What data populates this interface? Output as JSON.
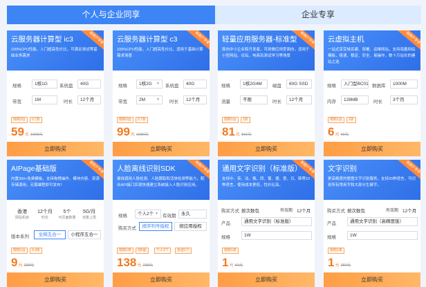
{
  "tabs": [
    "个人与企业同享",
    "企业专享"
  ],
  "products": [
    {
      "title": "云服务器计算型 ic3",
      "desc": "100%CPU性能，入门超高性价比，可满足测试等基础业务需求",
      "ribbon": "新用户专享",
      "specs": {
        "spec_label": "规格",
        "spec_value": "1核1G",
        "disk_label": "系统盘",
        "disk_value": "40G",
        "bw_label": "带宽",
        "bw_value": "1M",
        "dur_label": "时长",
        "dur_value": "12个月"
      },
      "badges": [
        "限购2台",
        "0.7折"
      ],
      "price": "59",
      "unit": "元",
      "old_price": "1008元",
      "buy": "立即购买"
    },
    {
      "title": "云服务器计算型 c3",
      "desc": "100%CPU性能，入门超高性价比，适用于基础计算需求场景",
      "ribbon": "新用户专享",
      "specs": {
        "spec_label": "规格",
        "spec_value": "1核2G",
        "disk_label": "系统盘",
        "disk_value": "40G",
        "bw_label": "带宽",
        "bw_value": "2M",
        "dur_label": "时长",
        "dur_value": "12个月"
      },
      "badges": [
        "限购2台",
        "0.7折"
      ],
      "price": "99",
      "unit": "元",
      "old_price": "1680元",
      "buy": "立即购买"
    },
    {
      "title": "轻量应用服务器-标准型",
      "desc": "面向中小企业和开发者，可用做应用型面向，适用于小型网站、论坛、电商及测试学习等场景",
      "ribbon": "新用户专享",
      "specs": {
        "spec_label": "规格",
        "spec_value": "1核2G4M",
        "disk_label": "磁盘",
        "disk_value": "60G SSD",
        "bw_label": "流量",
        "bw_value": "不限",
        "dur_label": "时长",
        "dur_value": "12个月"
      },
      "badges": [
        "限购1台",
        "1折"
      ],
      "price": "81",
      "unit": "元",
      "old_price": "816元",
      "buy": "立即购买"
    },
    {
      "title": "云虚拟主机",
      "desc": "一站式享受域名建、部署、运维网站，支持海量网站模板，极速、稳定、安全、易操作，数十万站长的建站之选",
      "ribbon": "新用户专享",
      "specs": {
        "spec_label": "规格",
        "spec_value": "入门型BC01",
        "disk_label": "数据库",
        "disk_value": "1000M",
        "bw_label": "内存",
        "bw_value": "128MB",
        "dur_label": "时长",
        "dur_value": "3个月"
      },
      "badges": [
        "限购1台",
        "1折"
      ],
      "price": "6",
      "unit": "元",
      "old_price": "69元",
      "buy": "立即购买"
    },
    {
      "title": "AIPage基础版",
      "desc": "内置300+免费模板，支持拖拽操作、模块内容、资源存储调用，无需编程即可发布！",
      "ribbon": "新用户专享",
      "stats": [
        {
          "value": "香港",
          "label": "网站机房"
        },
        {
          "value": "12个月",
          "label": "时长"
        },
        {
          "value": "5个",
          "label": "可页面数量"
        },
        {
          "value": "5G/月",
          "label": "流量上限"
        }
      ],
      "version_label": "版本系列",
      "options": [
        "全网五合一",
        "小程序五合一"
      ],
      "badges": [
        "限购1台",
        "0.4折"
      ],
      "price": "9",
      "unit": "元",
      "old_price": "298元",
      "buy": "立即购买"
    },
    {
      "title": "人脸离线识别SDK",
      "desc": "离线调用人脸检测、人脸跟踪和活体检测等能力，配合API接口实现快速建立系统接入人脸识别应用。",
      "ribbon": "新用户专享",
      "spec_label": "规格",
      "spec_value": "个人2个",
      "period_label": "有效期",
      "period_value": "永久",
      "method_label": "购买方式",
      "methods": [
        "按序列号授权",
        "按应用授权"
      ],
      "badges": [
        "限购1单",
        "0折起",
        "个人2个",
        "永远1个"
      ],
      "price": "138",
      "unit": "元",
      "old_price": "238元",
      "buy": "立即购买"
    },
    {
      "title": "通用文字识别（标准版）",
      "desc": "支持中、英、法、俄、西、葡、德、意、日、韩等10种语言，使用成本更低，性价比高。",
      "ribbon": "新用户专享",
      "method_label": "购买方式",
      "method_value": "按次数包",
      "period_label": "有效期",
      "period_value": "12个月",
      "product_label": "产品",
      "product_value": "通用文字识别（标准版）",
      "spec_label": "规格",
      "spec_value": "1W",
      "badges": [
        "限购1单"
      ],
      "price": "1",
      "unit": "元",
      "old_price": "50元",
      "buy": "立即购买"
    },
    {
      "title": "文字识别",
      "desc": "更高精度的整图文字识别服务，支持20种语言，可识别所有常用字和大部分生僻字。",
      "ribbon": "新用户专享",
      "method_label": "购买方式",
      "method_value": "按次数包",
      "period_label": "有效期",
      "period_value": "12个月",
      "product_label": "产品",
      "product_value": "通用文字识别（高精度版）",
      "spec_label": "规格",
      "spec_value": "1W",
      "badges": [
        "限购1单"
      ],
      "price": "1",
      "unit": "元",
      "old_price": "280元",
      "buy": "立即购买"
    }
  ]
}
